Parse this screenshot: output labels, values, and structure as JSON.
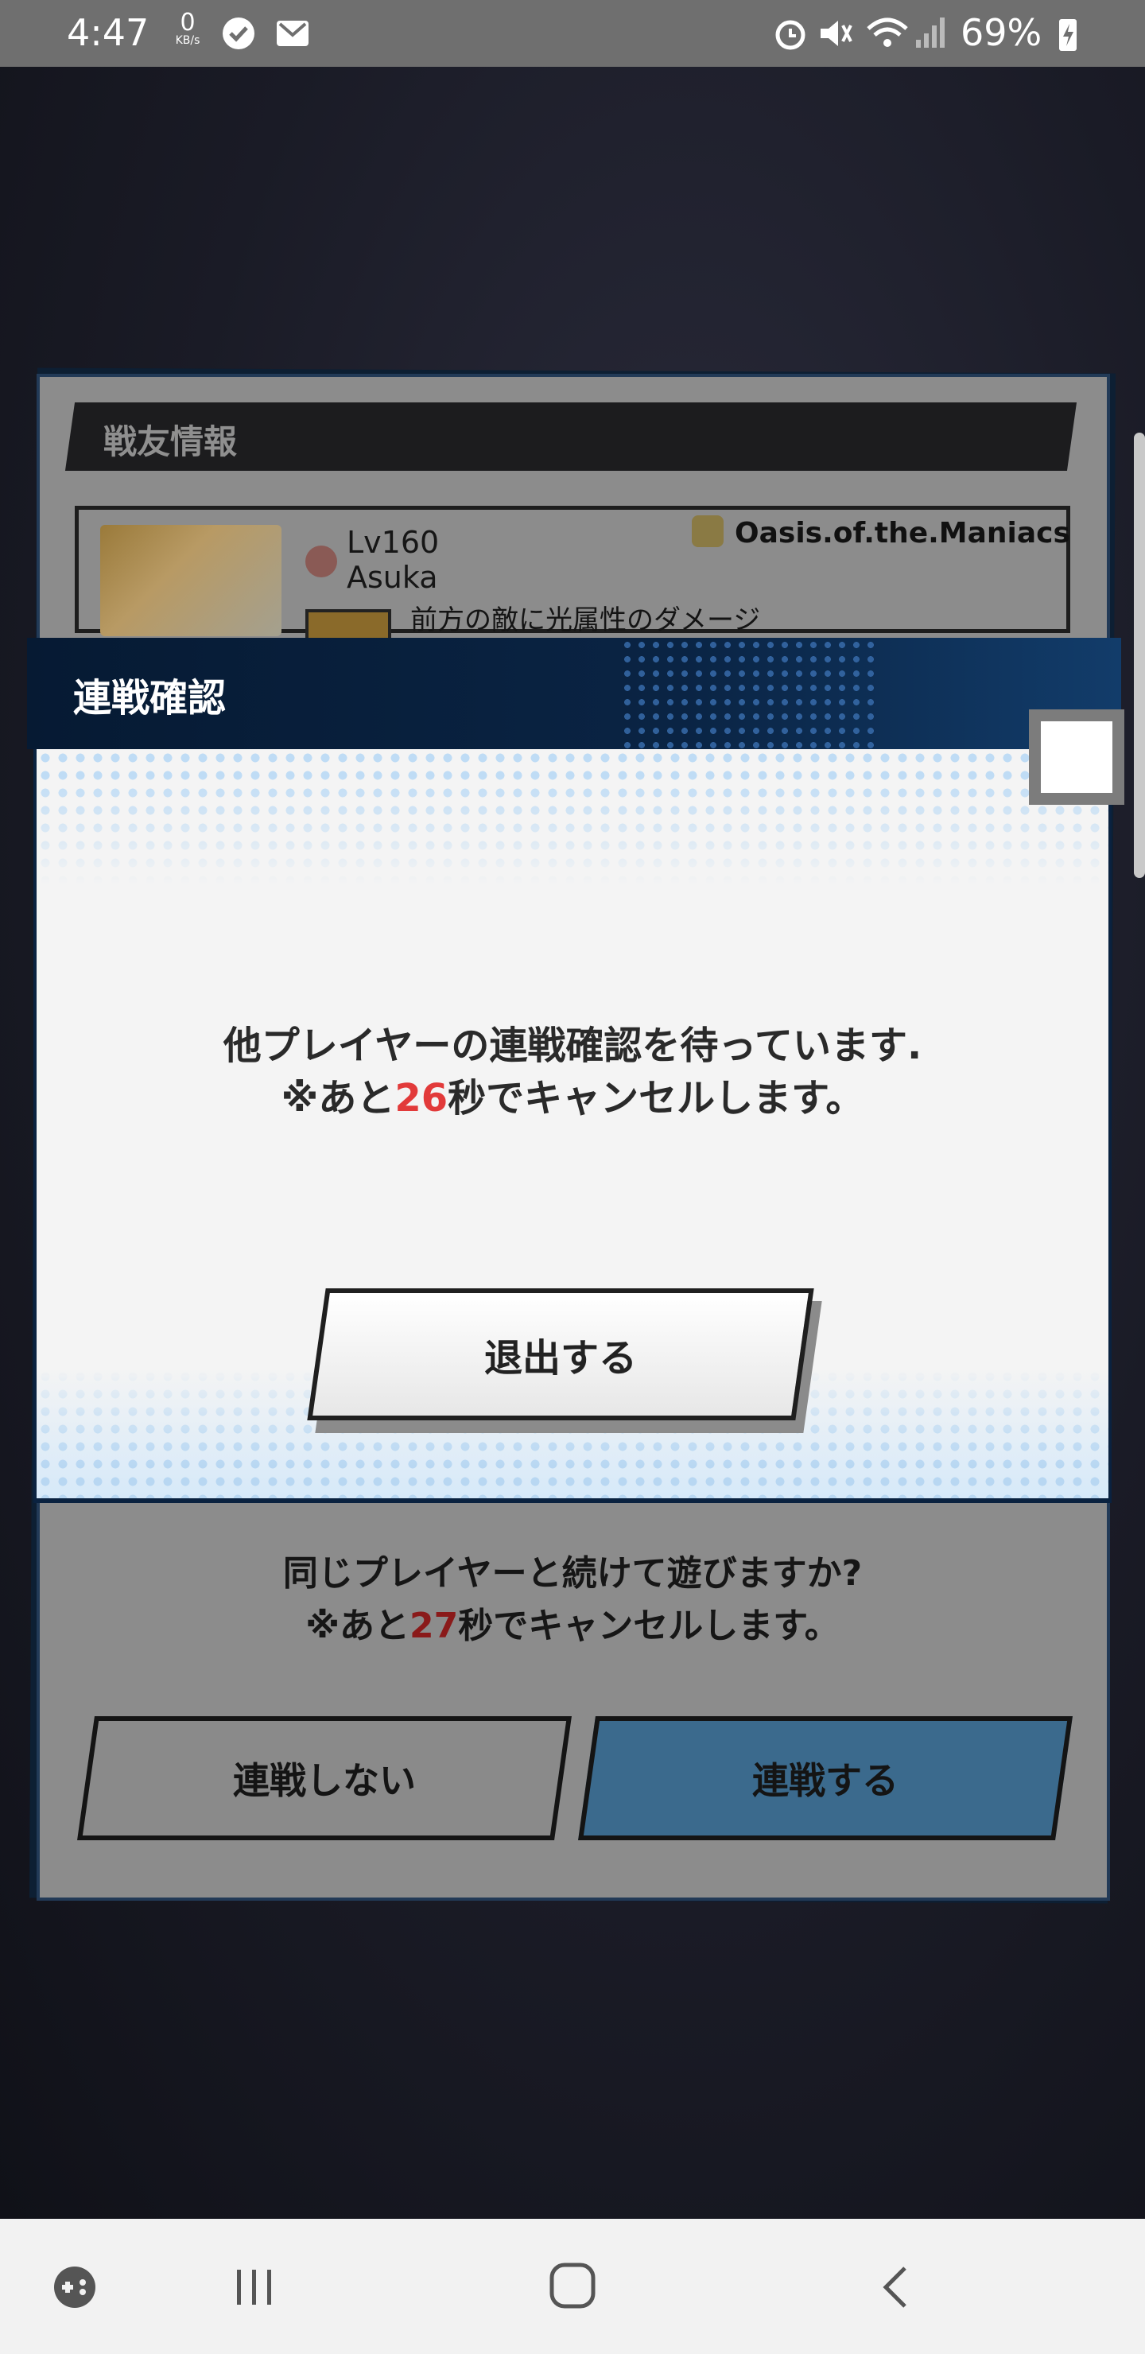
{
  "status_bar": {
    "time": "4:47",
    "data_rate_value": "0",
    "data_rate_unit": "KB/s",
    "battery": "69%"
  },
  "background_panel": {
    "title": "戦友情報",
    "friend_level": "Lv160",
    "friend_name": "Asuka",
    "guild_name": "Oasis.of.the.Maniacs",
    "skill_text": "前方の敵に光属性のダメージ",
    "question_line1": "同じプレイヤーと続けて遊びますか?",
    "question_prefix": "※あと",
    "question_seconds": "27",
    "question_suffix": "秒でキャンセルします。",
    "decline_button": "連戦しない",
    "accept_button": "連戦する"
  },
  "modal": {
    "title": "連戦確認",
    "message_line1": "他プレイヤーの連戦確認を待っています.",
    "message_prefix": "※あと",
    "message_seconds": "26",
    "message_suffix": "秒でキャンセルします。",
    "exit_button": "退出する"
  },
  "colors": {
    "accent_red": "#e23a3a",
    "header_navy": "#0a2444",
    "accept_blue": "#3b6a8d"
  }
}
